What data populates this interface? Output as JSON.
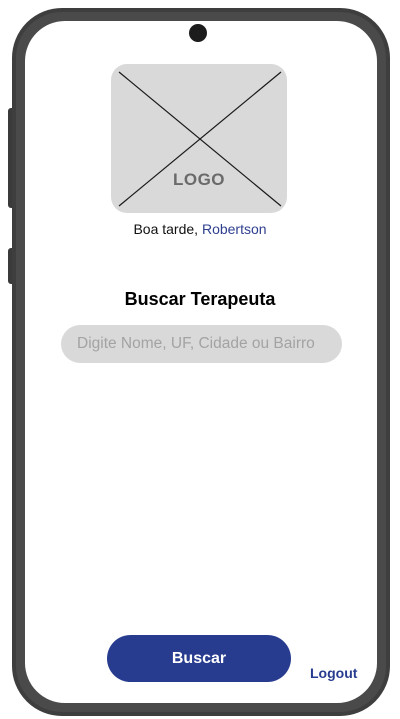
{
  "logo": {
    "text": "LOGO"
  },
  "greeting": {
    "prefix": "Boa tarde, ",
    "user_name": "Robertson"
  },
  "search": {
    "title": "Buscar Terapeuta",
    "placeholder": "Digite Nome, UF, Cidade ou Bairro",
    "button_label": "Buscar"
  },
  "footer": {
    "logout_label": "Logout"
  },
  "colors": {
    "primary": "#283c8f",
    "logo_placeholder": "#d9d9d9",
    "input_background": "#d9d9d9",
    "phone_frame": "#3e3e3e"
  },
  "icons": {
    "camera": "front-camera-icon",
    "logo": "image-placeholder-icon"
  }
}
